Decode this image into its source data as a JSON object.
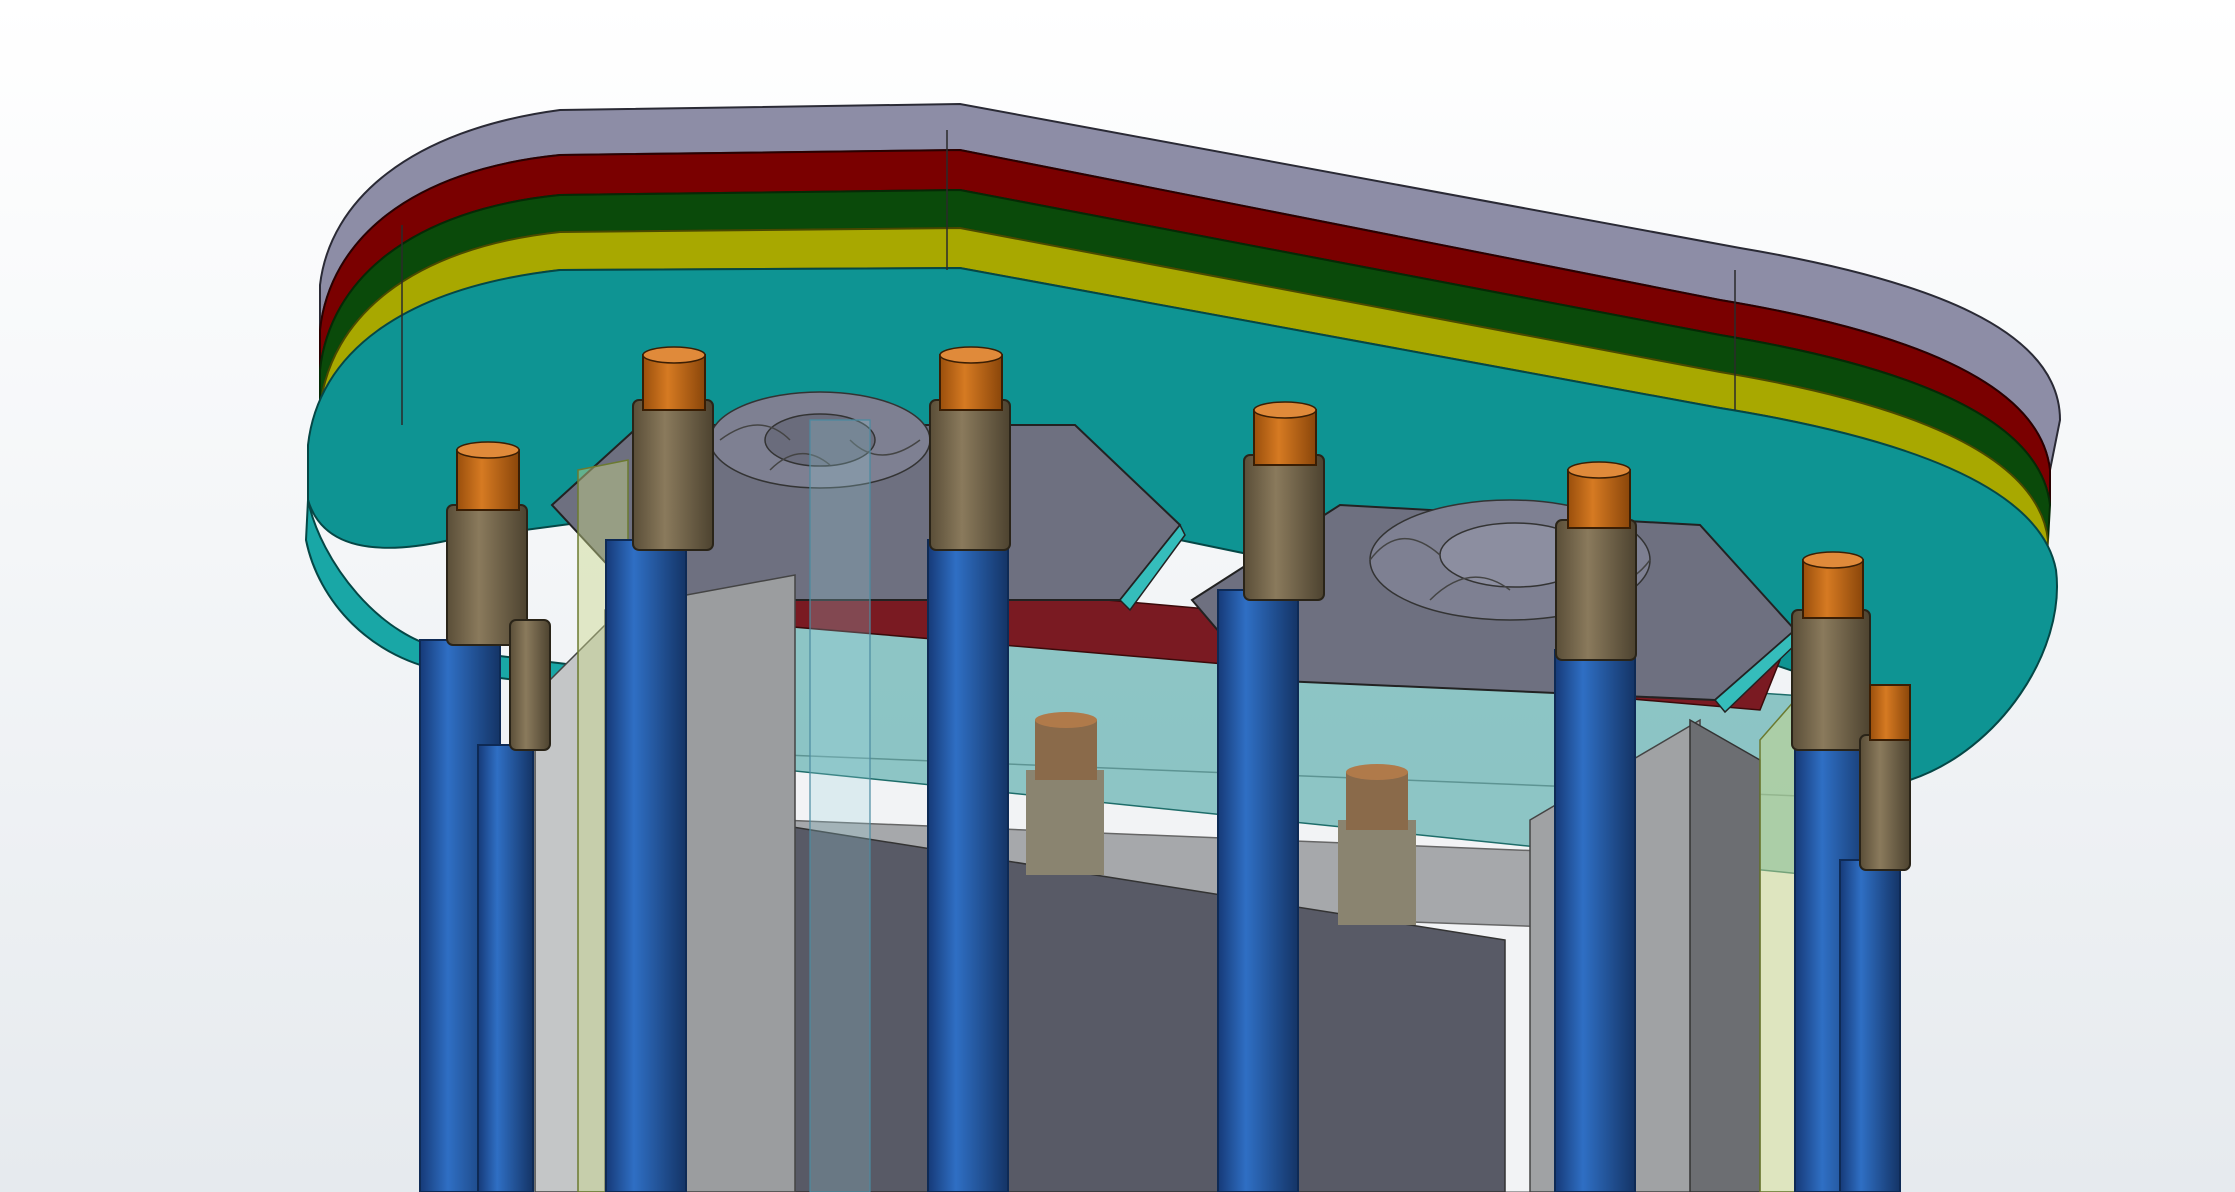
{
  "viewport": {
    "kind": "3d-cad-model-view",
    "background": [
      "#ffffff",
      "#e6eaee"
    ]
  },
  "model": {
    "plate_layer_colors": {
      "top_gray": "#8f8fa8",
      "red": "#7a0000",
      "green": "#0a4a0a",
      "yellow": "#b4b400",
      "teal": "#008a8a",
      "teal_light": "#1aa6a6"
    },
    "part_colors": {
      "rod": "#1f4f9a",
      "rod_highlight": "#2f6fc4",
      "standoff": "#6b5d45",
      "standoff_top": "#c26a14",
      "fan_housing": "#6e7080",
      "panel_gray": "#a9abae",
      "panel_dark": "#585a66",
      "glass": "#4fb7b0"
    },
    "rod_count": 7,
    "fan_count": 2,
    "fan_icon": "fan-icon"
  }
}
